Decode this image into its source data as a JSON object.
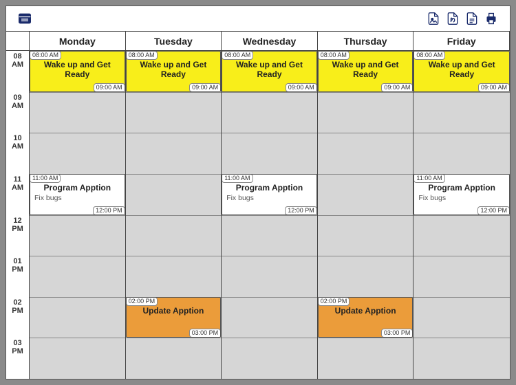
{
  "toolbar": {
    "list_view": "List view",
    "export_image": "Export image",
    "export_pdf": "Export PDF",
    "export_text": "Export text",
    "print": "Print"
  },
  "days": [
    "Monday",
    "Tuesday",
    "Wednesday",
    "Thursday",
    "Friday"
  ],
  "hours": [
    {
      "key": "08",
      "label_line1": "08",
      "label_line2": "AM"
    },
    {
      "key": "09",
      "label_line1": "09",
      "label_line2": "AM"
    },
    {
      "key": "10",
      "label_line1": "10",
      "label_line2": "AM"
    },
    {
      "key": "11",
      "label_line1": "11",
      "label_line2": "AM"
    },
    {
      "key": "12",
      "label_line1": "12",
      "label_line2": "PM"
    },
    {
      "key": "13",
      "label_line1": "01",
      "label_line2": "PM"
    },
    {
      "key": "14",
      "label_line1": "02",
      "label_line2": "PM"
    },
    {
      "key": "15",
      "label_line1": "03",
      "label_line2": "PM"
    }
  ],
  "hour_start": 8,
  "hour_end": 16,
  "events": [
    {
      "day": 0,
      "start": 8,
      "end": 9,
      "color": "yellow",
      "start_label": "08:00 AM",
      "end_label": "09:00 AM",
      "title": "Wake up and Get Ready",
      "desc": ""
    },
    {
      "day": 1,
      "start": 8,
      "end": 9,
      "color": "yellow",
      "start_label": "08:00 AM",
      "end_label": "09:00 AM",
      "title": "Wake up and Get Ready",
      "desc": ""
    },
    {
      "day": 2,
      "start": 8,
      "end": 9,
      "color": "yellow",
      "start_label": "08:00 AM",
      "end_label": "09:00 AM",
      "title": "Wake up and Get Ready",
      "desc": ""
    },
    {
      "day": 3,
      "start": 8,
      "end": 9,
      "color": "yellow",
      "start_label": "08:00 AM",
      "end_label": "09:00 AM",
      "title": "Wake up and Get Ready",
      "desc": ""
    },
    {
      "day": 4,
      "start": 8,
      "end": 9,
      "color": "yellow",
      "start_label": "08:00 AM",
      "end_label": "09:00 AM",
      "title": "Wake up and Get Ready",
      "desc": ""
    },
    {
      "day": 0,
      "start": 11,
      "end": 12,
      "color": "white",
      "start_label": "11:00 AM",
      "end_label": "12:00 PM",
      "title": "Program Apption",
      "desc": "Fix bugs"
    },
    {
      "day": 2,
      "start": 11,
      "end": 12,
      "color": "white",
      "start_label": "11:00 AM",
      "end_label": "12:00 PM",
      "title": "Program Apption",
      "desc": "Fix bugs"
    },
    {
      "day": 4,
      "start": 11,
      "end": 12,
      "color": "white",
      "start_label": "11:00 AM",
      "end_label": "12:00 PM",
      "title": "Program Apption",
      "desc": "Fix bugs"
    },
    {
      "day": 1,
      "start": 14,
      "end": 15,
      "color": "orange",
      "start_label": "02:00 PM",
      "end_label": "03:00 PM",
      "title": "Update Apption",
      "desc": ""
    },
    {
      "day": 3,
      "start": 14,
      "end": 15,
      "color": "orange",
      "start_label": "02:00 PM",
      "end_label": "03:00 PM",
      "title": "Update Apption",
      "desc": ""
    }
  ]
}
